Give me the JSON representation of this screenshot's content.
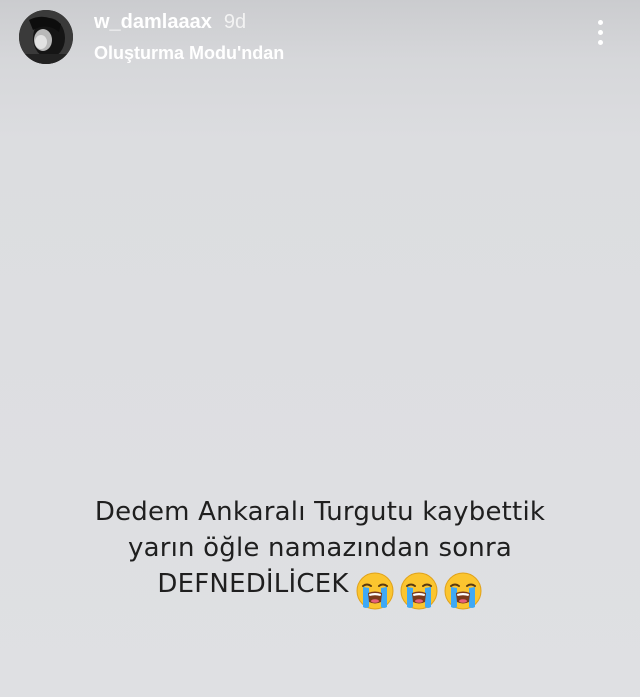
{
  "header": {
    "username": "w_damlaaax",
    "time_ago": "9d",
    "subtitle": "Oluşturma Modu'ndan"
  },
  "caption": {
    "line1": "Dedem Ankaralı Turgutu kaybettik",
    "line2": "yarın öğle namazından sonra",
    "line3": "DEFNEDİLİCEK",
    "emoji_count": 3,
    "emoji_name": "loudly-crying-face"
  },
  "colors": {
    "background": "#dcdde0",
    "header_text": "#ffffff",
    "caption_text": "#1f1f1f",
    "emoji_face": "#fbc52f",
    "emoji_tears": "#3fa9f5"
  }
}
